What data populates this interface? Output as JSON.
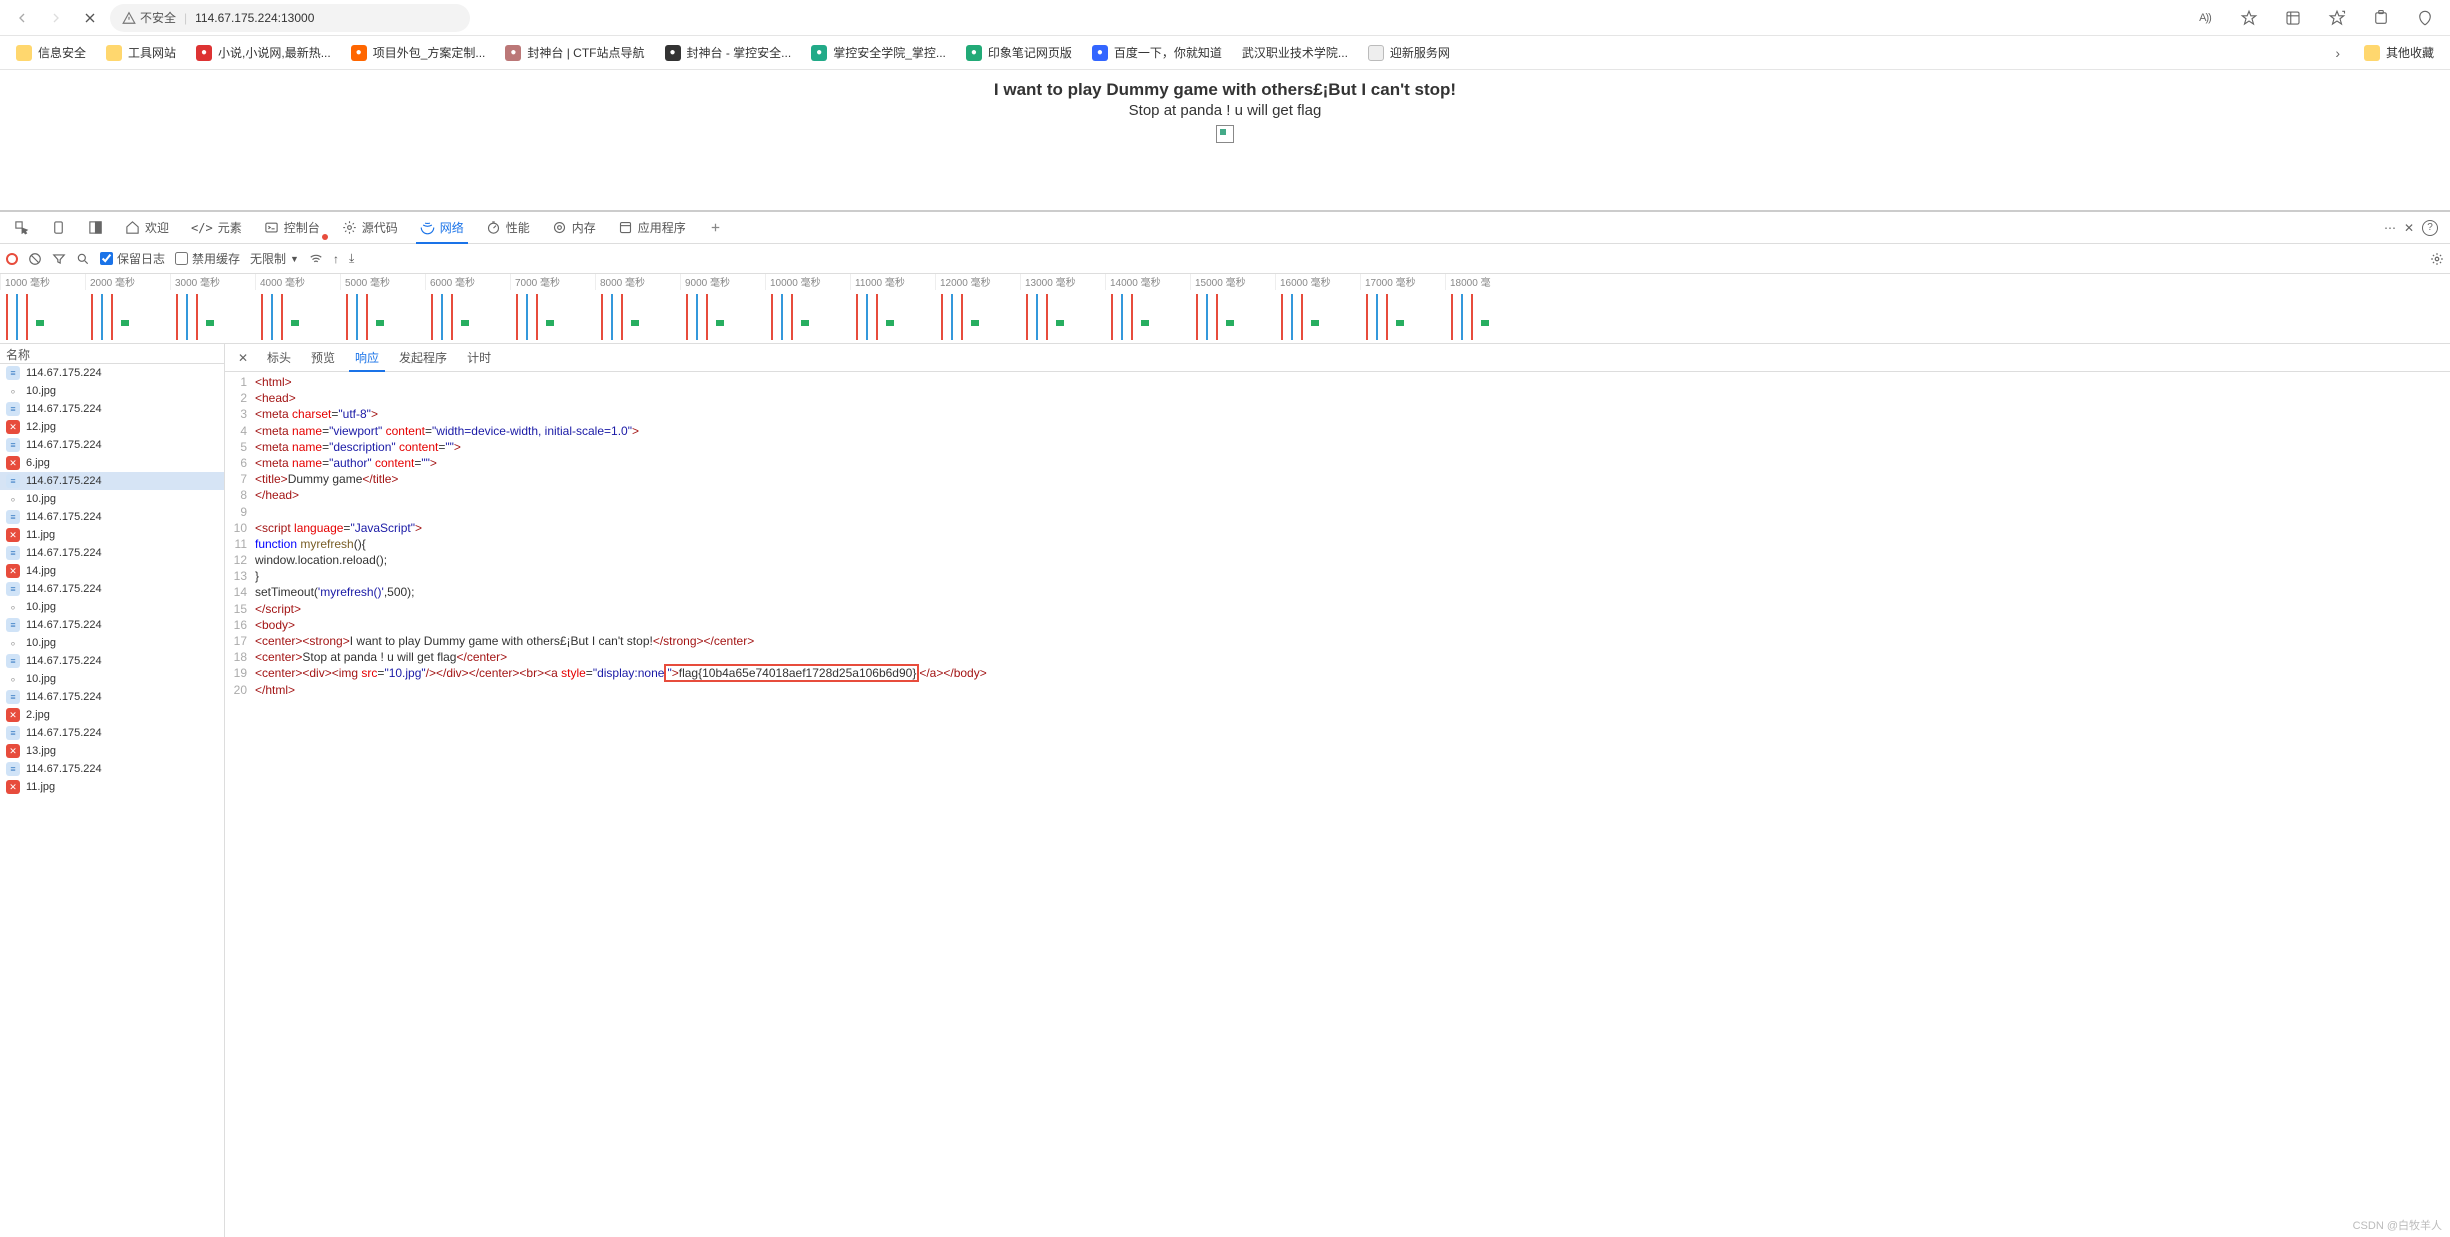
{
  "browser": {
    "insecure": "不安全",
    "url": "114.67.175.224:13000",
    "readAloudBadge": "A))"
  },
  "bookmarks": [
    {
      "label": "信息安全",
      "type": "folder"
    },
    {
      "label": "工具网站",
      "type": "folder"
    },
    {
      "label": "小说,小说网,最新热...",
      "type": "site",
      "color": "#d33"
    },
    {
      "label": "项目外包_方案定制...",
      "type": "site",
      "color": "#f60"
    },
    {
      "label": "封神台 | CTF站点导航",
      "type": "site",
      "color": "#b77"
    },
    {
      "label": "封神台 - 掌控安全...",
      "type": "site",
      "color": "#333"
    },
    {
      "label": "掌控安全学院_掌控...",
      "type": "site",
      "color": "#2a8"
    },
    {
      "label": "印象笔记网页版",
      "type": "site",
      "color": "#2a7"
    },
    {
      "label": "百度一下，你就知道",
      "type": "site",
      "color": "#36f"
    },
    {
      "label": "武汉职业技术学院...",
      "type": "text"
    },
    {
      "label": "迎新服务网",
      "type": "doc"
    },
    {
      "label": "其他收藏",
      "type": "folder-right"
    }
  ],
  "page": {
    "title": "I want to play Dummy game with others£¡But I can't stop!",
    "subtitle": "Stop at panda ! u will get flag"
  },
  "devtools": {
    "tabs": {
      "welcome": "欢迎",
      "elements": "元素",
      "console": "控制台",
      "sources": "源代码",
      "network": "网络",
      "performance": "性能",
      "memory": "内存",
      "application": "应用程序"
    },
    "toolbar": {
      "preserveLog": "保留日志",
      "disableCache": "禁用缓存",
      "noThrottle": "无限制"
    },
    "ruler": [
      "1000 毫秒",
      "2000 毫秒",
      "3000 毫秒",
      "4000 毫秒",
      "5000 毫秒",
      "6000 毫秒",
      "7000 毫秒",
      "8000 毫秒",
      "9000 毫秒",
      "10000 毫秒",
      "11000 毫秒",
      "12000 毫秒",
      "13000 毫秒",
      "14000 毫秒",
      "15000 毫秒",
      "16000 毫秒",
      "17000 毫秒",
      "18000 毫"
    ],
    "namesHeader": "名称",
    "requests": [
      {
        "n": "114.67.175.224",
        "s": "ok"
      },
      {
        "n": "10.jpg",
        "s": "dot"
      },
      {
        "n": "114.67.175.224",
        "s": "ok"
      },
      {
        "n": "12.jpg",
        "s": "err"
      },
      {
        "n": "114.67.175.224",
        "s": "ok"
      },
      {
        "n": "6.jpg",
        "s": "err"
      },
      {
        "n": "114.67.175.224",
        "s": "ok",
        "sel": true
      },
      {
        "n": "10.jpg",
        "s": "dot"
      },
      {
        "n": "114.67.175.224",
        "s": "ok"
      },
      {
        "n": "11.jpg",
        "s": "err"
      },
      {
        "n": "114.67.175.224",
        "s": "ok"
      },
      {
        "n": "14.jpg",
        "s": "err"
      },
      {
        "n": "114.67.175.224",
        "s": "ok"
      },
      {
        "n": "10.jpg",
        "s": "dot"
      },
      {
        "n": "114.67.175.224",
        "s": "ok"
      },
      {
        "n": "10.jpg",
        "s": "dot"
      },
      {
        "n": "114.67.175.224",
        "s": "ok"
      },
      {
        "n": "10.jpg",
        "s": "dot"
      },
      {
        "n": "114.67.175.224",
        "s": "ok"
      },
      {
        "n": "2.jpg",
        "s": "err"
      },
      {
        "n": "114.67.175.224",
        "s": "ok"
      },
      {
        "n": "13.jpg",
        "s": "err"
      },
      {
        "n": "114.67.175.224",
        "s": "ok"
      },
      {
        "n": "11.jpg",
        "s": "err"
      }
    ],
    "detailTabs": {
      "headers": "标头",
      "preview": "预览",
      "response": "响应",
      "initiator": "发起程序",
      "timing": "计时"
    },
    "flag": "flag{10b4a65e74018aef1728d25a106b6d90}"
  },
  "watermark": "CSDN @白牧羊人"
}
